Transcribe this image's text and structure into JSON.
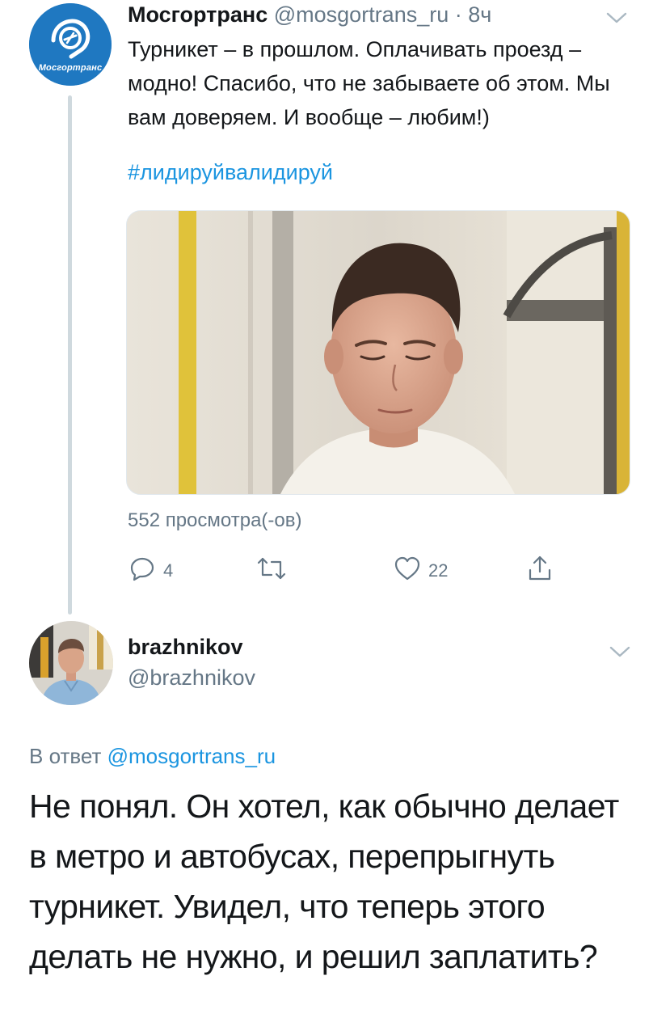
{
  "tweet": {
    "author": {
      "display_name": "Мосгортранс",
      "handle": "@mosgortrans_ru",
      "separator": "·",
      "time": "8ч",
      "avatar_text": "Мосгортранс",
      "avatar_color": "#1f78c1"
    },
    "text": "Турникет – в прошлом. Оплачивать проезд – модно! Спасибо, что не забываете об этом. Мы вам доверяем. И вообще – любим!)",
    "hashtag": "#лидируйвалидируй",
    "views": "552 просмотра(-ов)",
    "actions": {
      "reply_icon": "reply-icon",
      "reply_count": "4",
      "retweet_icon": "retweet-icon",
      "like_icon": "heart-icon",
      "like_count": "22",
      "share_icon": "share-icon"
    }
  },
  "reply": {
    "author": {
      "display_name": "brazhnikov",
      "handle": "@brazhnikov"
    },
    "reply_to_prefix": "В ответ",
    "reply_to_handle": "@mosgortrans_ru",
    "text": "Не понял. Он хотел, как обычно делает в метро и автобусах, перепрыгнуть турникет. Увидел, что теперь этого делать не нужно, и решил заплатить?"
  },
  "colors": {
    "link": "#1b95e0",
    "secondary_text": "#657786",
    "primary_text": "#14171a",
    "thread_line": "#cfd9de"
  }
}
